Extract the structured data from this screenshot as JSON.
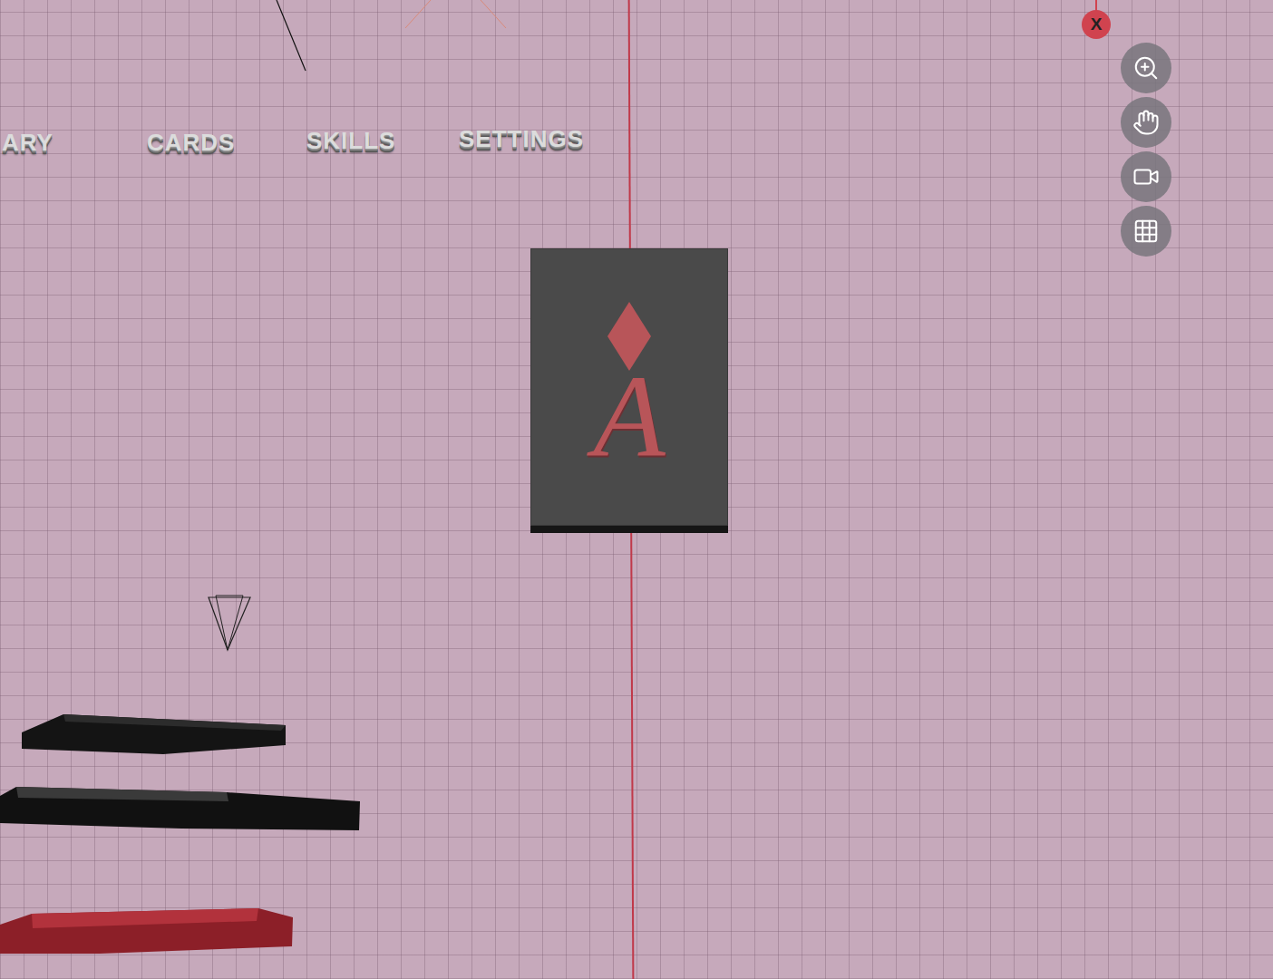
{
  "viewport": {
    "axis_label": "X"
  },
  "menu_labels": [
    {
      "label": "ARY"
    },
    {
      "label": "CARDS"
    },
    {
      "label": "SKILLS"
    },
    {
      "label": "SETTINGS"
    }
  ],
  "card": {
    "letter": "A"
  }
}
